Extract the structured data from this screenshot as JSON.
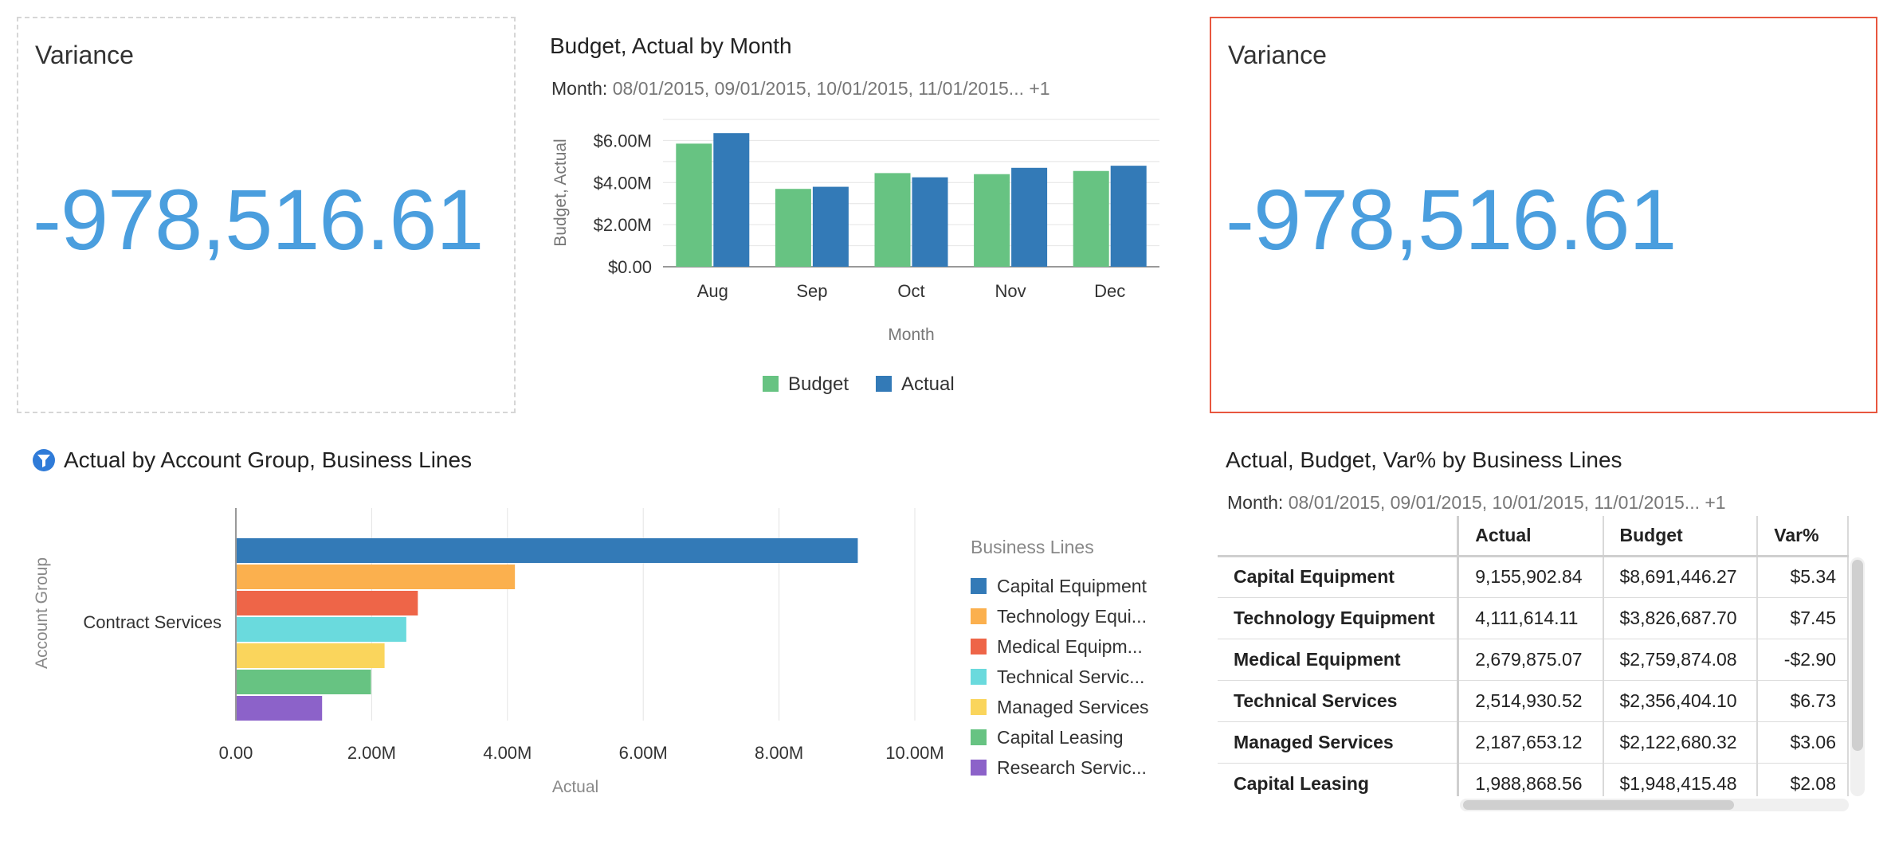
{
  "kpi_left": {
    "title": "Variance",
    "value": "-978,516.61"
  },
  "kpi_right": {
    "title": "Variance",
    "value": "-978,516.61"
  },
  "budget_actual": {
    "title": "Budget, Actual by Month",
    "filter_label": "Month:",
    "filter_value": "08/01/2015, 09/01/2015, 10/01/2015, 11/01/2015... +1"
  },
  "account_group": {
    "title": "Actual by Account Group, Business Lines"
  },
  "table_section": {
    "title": "Actual, Budget, Var% by Business Lines",
    "filter_label": "Month:",
    "filter_value": "08/01/2015, 09/01/2015, 10/01/2015, 11/01/2015... +1",
    "headers": [
      "",
      "Actual",
      "Budget",
      "Var%"
    ],
    "rows": [
      [
        "Capital Equipment",
        "9,155,902.84",
        "$8,691,446.27",
        "$5.34"
      ],
      [
        "Technology Equipment",
        "4,111,614.11",
        "$3,826,687.70",
        "$7.45"
      ],
      [
        "Medical Equipment",
        "2,679,875.07",
        "$2,759,874.08",
        "-$2.90"
      ],
      [
        "Technical Services",
        "2,514,930.52",
        "$2,356,404.10",
        "$6.73"
      ],
      [
        "Managed Services",
        "2,187,653.12",
        "$2,122,680.32",
        "$3.06"
      ],
      [
        "Capital Leasing",
        "1,988,868.56",
        "$1,948,415.48",
        "$2.08"
      ]
    ]
  },
  "chart_data": [
    {
      "type": "bar",
      "title": "Budget, Actual by Month",
      "categories": [
        "Aug",
        "Sep",
        "Oct",
        "Nov",
        "Dec"
      ],
      "series": [
        {
          "name": "Budget",
          "color": "#67c382",
          "values": [
            5.85,
            3.7,
            4.45,
            4.4,
            4.55
          ]
        },
        {
          "name": "Actual",
          "color": "#337ab7",
          "values": [
            6.35,
            3.8,
            4.25,
            4.7,
            4.8
          ]
        }
      ],
      "xlabel": "Month",
      "ylabel": "Budget, Actual",
      "yticks": [
        "$0.00",
        "$2.00M",
        "$4.00M",
        "$6.00M"
      ],
      "ylim": [
        0,
        7
      ],
      "unit": "M",
      "legend": "bottom",
      "grid": true
    },
    {
      "type": "bar",
      "orientation": "horizontal",
      "title": "Actual by Account Group, Business Lines",
      "categories": [
        "Contract Services"
      ],
      "series": [
        {
          "name": "Capital Equipment",
          "color": "#337ab7",
          "values": [
            9.16
          ]
        },
        {
          "name": "Technology Equi...",
          "color": "#fbb04e",
          "values": [
            4.11
          ]
        },
        {
          "name": "Medical Equipm...",
          "color": "#ee6548",
          "values": [
            2.68
          ]
        },
        {
          "name": "Technical Servic...",
          "color": "#6adadd",
          "values": [
            2.51
          ]
        },
        {
          "name": "Managed Services",
          "color": "#fad55c",
          "values": [
            2.19
          ]
        },
        {
          "name": "Capital Leasing",
          "color": "#67c382",
          "values": [
            1.99
          ]
        },
        {
          "name": "Research Servic...",
          "color": "#8c62c9",
          "values": [
            1.27
          ]
        }
      ],
      "xlabel": "Actual",
      "ylabel": "Account Group",
      "xticks": [
        "0.00",
        "2.00M",
        "4.00M",
        "6.00M",
        "8.00M",
        "10.00M"
      ],
      "xlim": [
        0,
        10
      ],
      "unit": "M",
      "legend_title": "Business Lines",
      "legend": "right",
      "grid": true
    }
  ]
}
